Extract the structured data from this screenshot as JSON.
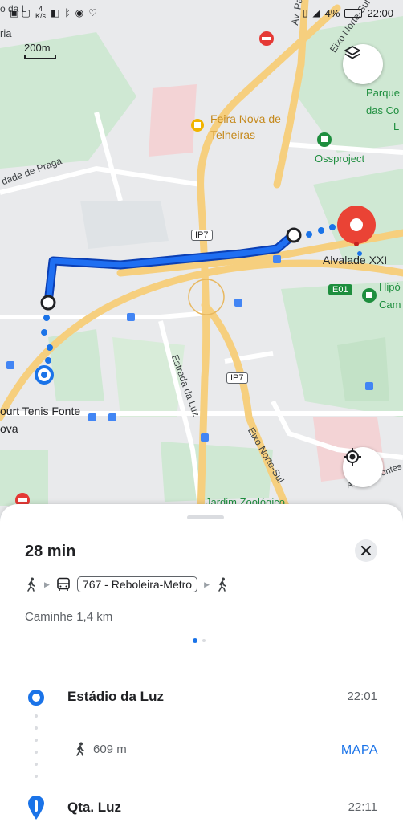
{
  "statusbar": {
    "speed_value": "4",
    "speed_unit": "K/s",
    "battery": "4%",
    "time": "22:00"
  },
  "map": {
    "scale": "200m",
    "labels": {
      "feira": "Feira Nova de",
      "feira2": "Telheiras",
      "ossproject": "Ossproject",
      "parque1": "Parque",
      "parque2": "das Co",
      "parque3": "L",
      "alvalade": "Alvalade XXI",
      "hipo1": "Hipó",
      "hipo2": "Cam",
      "praga": "dade de Praga",
      "padre_cruz": "Av. Padre Cruz",
      "eixo_top": "Eixo Norte-Sul",
      "eixo_bottom": "Eixo Norte-Sul",
      "estrada_luz": "Estrada da Luz",
      "tenis1": "ourt Tenis Fonte",
      "tenis2": "ova",
      "jardim": "Jardim Zoológico",
      "av_fontes": "Av. dos Fontes",
      "top_left": "o da L",
      "top_left2": "ria"
    },
    "shields": {
      "ip7_top": "IP7",
      "ip7_bottom": "IP7",
      "e01": "E01"
    }
  },
  "sheet": {
    "duration": "28 min",
    "route_chip": "767 - Reboleira-Metro",
    "walk_summary": "Caminhe 1,4 km",
    "origin_stop": "Estádio da Luz",
    "origin_time": "22:01",
    "walk_distance": "609 m",
    "mapa_label": "MAPA",
    "next_stop": "Qta. Luz",
    "next_time": "22:11"
  },
  "colors": {
    "route": "#1a5fe0",
    "accent": "#1a73e8",
    "destination": "#ea4335",
    "roads_major": "#f6cf7e"
  },
  "icons": {
    "layers": "layers-icon",
    "locate": "my-location-icon",
    "close": "close-icon",
    "walk": "walking-icon",
    "bus": "bus-icon"
  }
}
